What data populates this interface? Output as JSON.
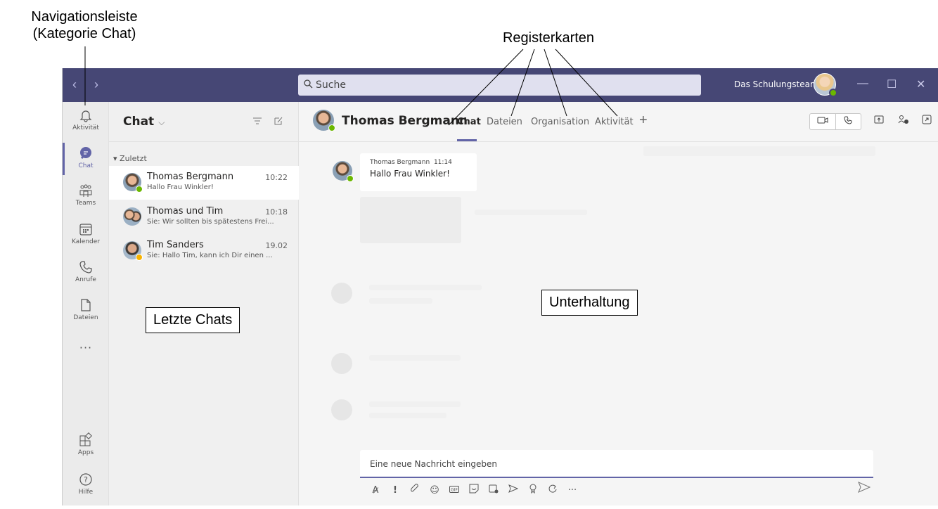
{
  "annotations": {
    "navigation_label_line1": "Navigationsleiste",
    "navigation_label_line2": "(Kategorie Chat)",
    "tabs_label": "Registerkarten",
    "recent_chats_label": "Letzte Chats",
    "conversation_label": "Unterhaltung"
  },
  "titlebar": {
    "nav_arrows": "‹ ›",
    "search_placeholder": "Suche",
    "team_name": "Das Schulungsteam",
    "minimize": "—",
    "maximize": "☐",
    "close": "✕"
  },
  "rail": {
    "items": [
      {
        "label": "Aktivität",
        "icon": "bell-icon"
      },
      {
        "label": "Chat",
        "icon": "chat-icon"
      },
      {
        "label": "Teams",
        "icon": "teams-icon"
      },
      {
        "label": "Kalender",
        "icon": "calendar-icon"
      },
      {
        "label": "Anrufe",
        "icon": "phone-icon"
      },
      {
        "label": "Dateien",
        "icon": "file-icon"
      }
    ],
    "more": "···",
    "apps_label": "Apps",
    "help_label": "Hilfe"
  },
  "chatlist": {
    "title": "Chat",
    "section": "Zuletzt",
    "chats": [
      {
        "name": "Thomas Bergmann",
        "time": "10:22",
        "preview": "Hallo Frau Winkler!",
        "status_color": "#6bb700"
      },
      {
        "name": "Thomas und Tim",
        "time": "10:18",
        "preview": "Sie: Wir sollten bis spätestens Frei...",
        "status_color": ""
      },
      {
        "name": "Tim Sanders",
        "time": "19.02",
        "preview": "Sie: Hallo Tim, kann ich Dir einen ...",
        "status_color": "#f8b200"
      }
    ]
  },
  "main": {
    "contact_name": "Thomas Bergmann",
    "tabs": [
      "Chat",
      "Dateien",
      "Organisation",
      "Aktivität"
    ],
    "add_tab": "+",
    "message": {
      "sender": "Thomas Bergmann",
      "time": "11:14",
      "text": "Hallo Frau Winkler!"
    },
    "compose_placeholder": "Eine neue Nachricht eingeben"
  },
  "colors": {
    "titlebar": "#464775",
    "accent": "#6264a7",
    "online": "#6bb700",
    "away": "#f8b200"
  }
}
